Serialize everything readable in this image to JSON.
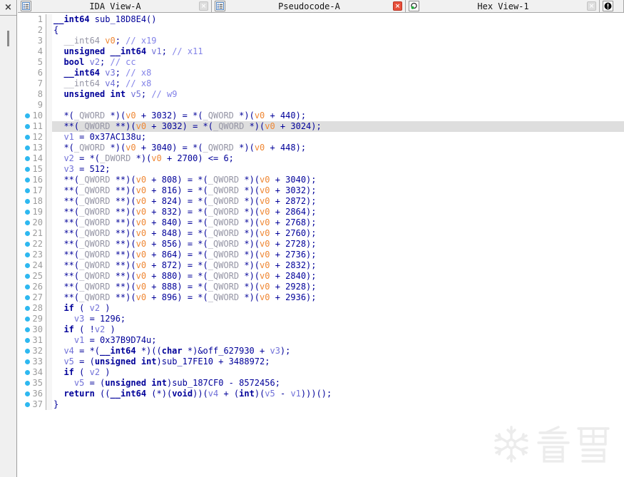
{
  "window": {
    "app": "IDA Pro",
    "active_view": "Pseudocode-A"
  },
  "rail": {
    "close_label": "×"
  },
  "tabs": [
    {
      "title": "IDA View-A",
      "icon": "list-view-icon",
      "close_style": "inactive"
    },
    {
      "title": "Pseudocode-A",
      "icon": "list-view-icon",
      "close_style": "active"
    },
    {
      "title": "Hex View-1",
      "icon": "hex-view-icon",
      "close_style": "inactive"
    },
    {
      "title": "",
      "icon": "info-icon",
      "close_style": "none"
    }
  ],
  "code": {
    "language": "c-pseudocode",
    "highlight_line": 11,
    "highlighted_identifier": "v0",
    "lines": [
      {
        "n": 1,
        "dot": false,
        "text": "__int64 sub_18D8E4()"
      },
      {
        "n": 2,
        "dot": false,
        "text": "{"
      },
      {
        "n": 3,
        "dot": false,
        "dim": true,
        "text": "  __int64 v0; // x19"
      },
      {
        "n": 4,
        "dot": false,
        "text": "  unsigned __int64 v1; // x11"
      },
      {
        "n": 5,
        "dot": false,
        "text": "  bool v2; // cc"
      },
      {
        "n": 6,
        "dot": false,
        "text": "  __int64 v3; // x8"
      },
      {
        "n": 7,
        "dot": false,
        "dim": true,
        "text": "  __int64 v4; // x8"
      },
      {
        "n": 8,
        "dot": false,
        "text": "  unsigned int v5; // w9"
      },
      {
        "n": 9,
        "dot": false,
        "text": ""
      },
      {
        "n": 10,
        "dot": true,
        "text": "  *(_QWORD *)(v0 + 3032) = *(_QWORD *)(v0 + 440);"
      },
      {
        "n": 11,
        "dot": true,
        "text": "  **(_QWORD **)(v0 + 3032) = *(_QWORD *)(v0 + 3024);"
      },
      {
        "n": 12,
        "dot": true,
        "text": "  v1 = 0x37AC138u;"
      },
      {
        "n": 13,
        "dot": true,
        "text": "  *(_QWORD *)(v0 + 3040) = *(_QWORD *)(v0 + 448);"
      },
      {
        "n": 14,
        "dot": true,
        "text": "  v2 = *(_DWORD *)(v0 + 2700) <= 6;"
      },
      {
        "n": 15,
        "dot": true,
        "text": "  v3 = 512;"
      },
      {
        "n": 16,
        "dot": true,
        "text": "  **(_QWORD **)(v0 + 808) = *(_QWORD *)(v0 + 3040);"
      },
      {
        "n": 17,
        "dot": true,
        "text": "  **(_QWORD **)(v0 + 816) = *(_QWORD *)(v0 + 3032);"
      },
      {
        "n": 18,
        "dot": true,
        "text": "  **(_QWORD **)(v0 + 824) = *(_QWORD *)(v0 + 2872);"
      },
      {
        "n": 19,
        "dot": true,
        "text": "  **(_QWORD **)(v0 + 832) = *(_QWORD *)(v0 + 2864);"
      },
      {
        "n": 20,
        "dot": true,
        "text": "  **(_QWORD **)(v0 + 840) = *(_QWORD *)(v0 + 2768);"
      },
      {
        "n": 21,
        "dot": true,
        "text": "  **(_QWORD **)(v0 + 848) = *(_QWORD *)(v0 + 2760);"
      },
      {
        "n": 22,
        "dot": true,
        "text": "  **(_QWORD **)(v0 + 856) = *(_QWORD *)(v0 + 2728);"
      },
      {
        "n": 23,
        "dot": true,
        "text": "  **(_QWORD **)(v0 + 864) = *(_QWORD *)(v0 + 2736);"
      },
      {
        "n": 24,
        "dot": true,
        "text": "  **(_QWORD **)(v0 + 872) = *(_QWORD *)(v0 + 2832);"
      },
      {
        "n": 25,
        "dot": true,
        "text": "  **(_QWORD **)(v0 + 880) = *(_QWORD *)(v0 + 2840);"
      },
      {
        "n": 26,
        "dot": true,
        "text": "  **(_QWORD **)(v0 + 888) = *(_QWORD *)(v0 + 2928);"
      },
      {
        "n": 27,
        "dot": true,
        "text": "  **(_QWORD **)(v0 + 896) = *(_QWORD *)(v0 + 2936);"
      },
      {
        "n": 28,
        "dot": true,
        "text": "  if ( v2 )"
      },
      {
        "n": 29,
        "dot": true,
        "text": "    v3 = 1296;"
      },
      {
        "n": 30,
        "dot": true,
        "text": "  if ( !v2 )"
      },
      {
        "n": 31,
        "dot": true,
        "text": "    v1 = 0x37B9D74u;"
      },
      {
        "n": 32,
        "dot": true,
        "text": "  v4 = *(__int64 *)((char *)&off_627930 + v3);"
      },
      {
        "n": 33,
        "dot": true,
        "text": "  v5 = (unsigned int)sub_17FE10 + 3488972;"
      },
      {
        "n": 34,
        "dot": true,
        "text": "  if ( v2 )"
      },
      {
        "n": 35,
        "dot": true,
        "text": "    v5 = (unsigned int)sub_187CF0 - 8572456;"
      },
      {
        "n": 36,
        "dot": true,
        "text": "  return ((__int64 (*)(void))(v4 + (int)(v5 - v1)))();"
      },
      {
        "n": 37,
        "dot": true,
        "text": "}"
      }
    ]
  },
  "watermark": {
    "text": "看雪",
    "icon": "snowflake-icon"
  },
  "colors": {
    "code-navy": "#000099",
    "type-gray": "#9595a5",
    "var-lavender": "#7070d8",
    "v0-orange": "#ef8733",
    "comment-blue": "#8282e8",
    "dot-cyan": "#2eb8f0",
    "line-num": "#9b9b9b",
    "hl-bg": "#dedede",
    "close-red": "#e8513c",
    "tabbar-bg": "#f1f1f1",
    "rail-bg": "#f0f0f0"
  }
}
